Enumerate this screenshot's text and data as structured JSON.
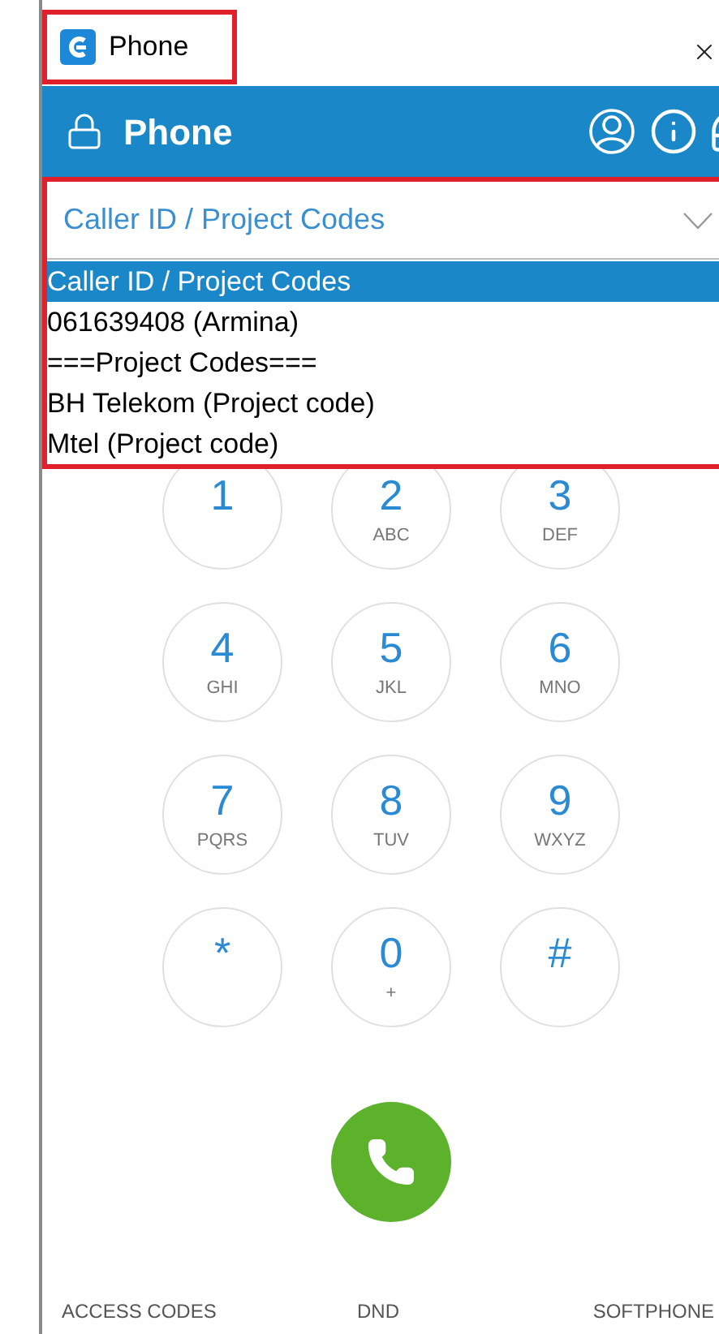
{
  "window": {
    "title": "Phone",
    "highlighted": true
  },
  "header": {
    "title": "Phone"
  },
  "caller_id": {
    "value": "Caller ID / Project Codes",
    "expanded": true,
    "highlighted": true,
    "options": [
      {
        "label": "Caller ID / Project Codes",
        "selected": true
      },
      {
        "label": "061639408 (Armina)",
        "selected": false
      },
      {
        "label": "===Project Codes===",
        "selected": false
      },
      {
        "label": "BH Telekom (Project code)",
        "selected": false
      },
      {
        "label": "Mtel (Project code)",
        "selected": false
      }
    ]
  },
  "keypad": [
    {
      "digit": "1"
    },
    {
      "digit": "2",
      "letters": "ABC"
    },
    {
      "digit": "3",
      "letters": "DEF"
    },
    {
      "digit": "4",
      "letters": "GHI"
    },
    {
      "digit": "5",
      "letters": "JKL"
    },
    {
      "digit": "6",
      "letters": "MNO"
    },
    {
      "digit": "7",
      "letters": "PQRS"
    },
    {
      "digit": "8",
      "letters": "TUV"
    },
    {
      "digit": "9",
      "letters": "WXYZ"
    },
    {
      "digit": "*"
    },
    {
      "digit": "0",
      "letters": "+"
    },
    {
      "digit": "#"
    }
  ],
  "footer": [
    "ACCESS CODES",
    "DND",
    "SOFTPHONE"
  ]
}
